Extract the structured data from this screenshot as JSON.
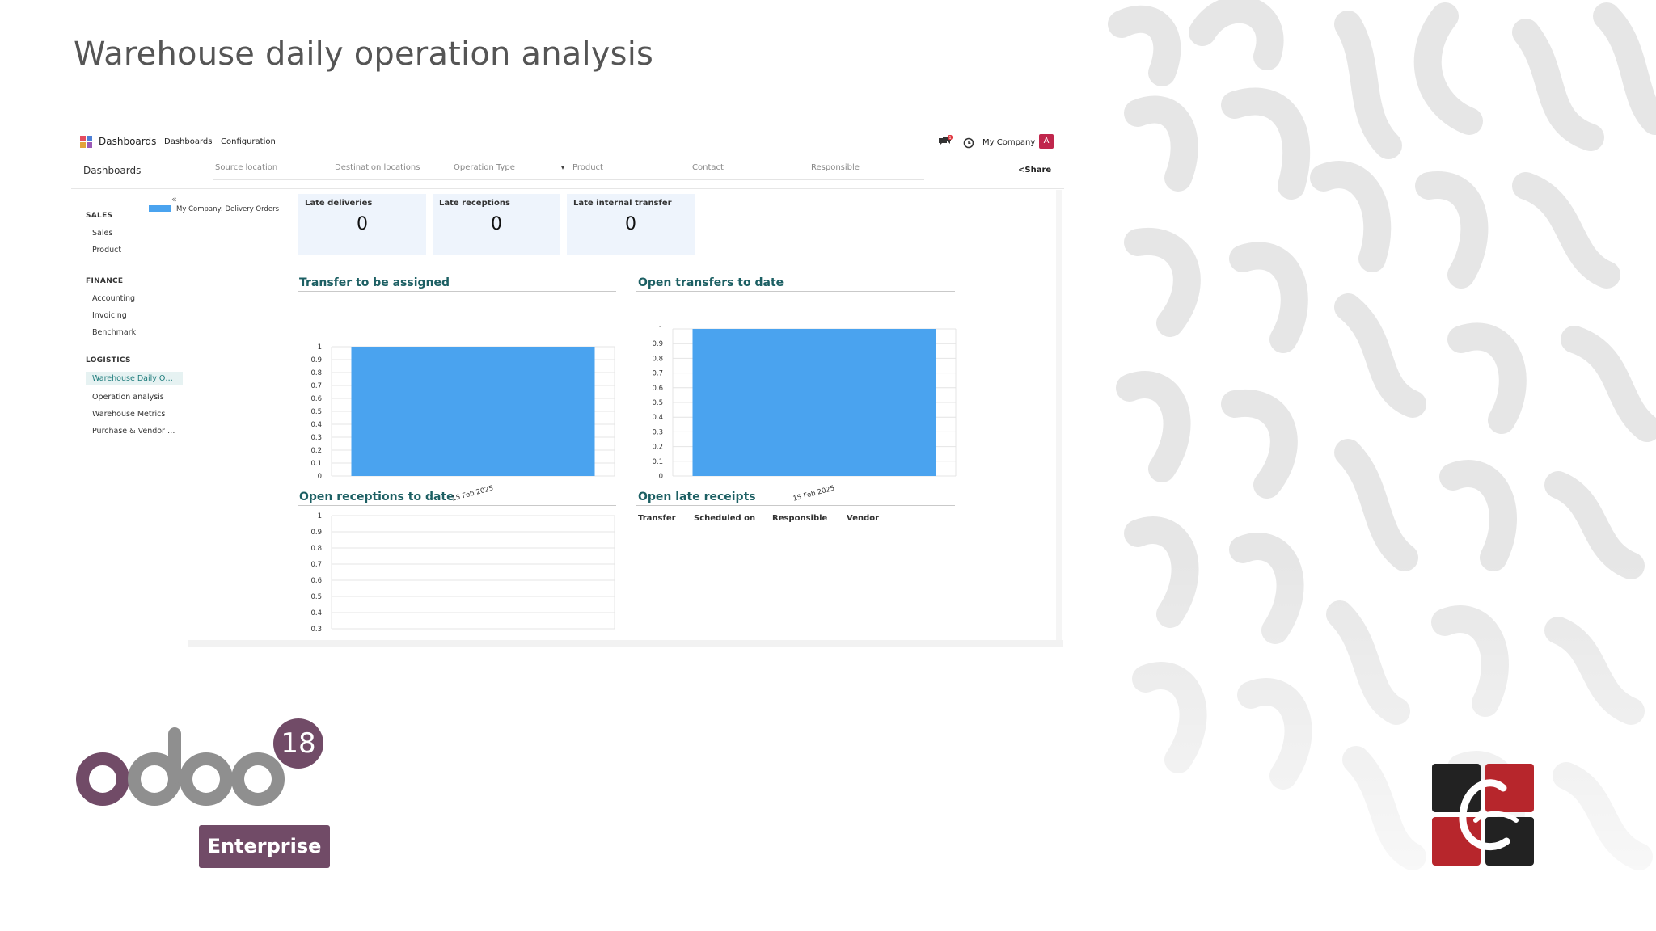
{
  "slide": {
    "title": "Warehouse daily operation analysis"
  },
  "navbar": {
    "app_name": "Dashboards",
    "menu": [
      "Dashboards",
      "Configuration"
    ],
    "chat_badge": "1",
    "company": "My Company",
    "avatar_letter": "A"
  },
  "controlbar": {
    "breadcrumb": "Dashboards",
    "filters": [
      "Source location",
      "Destination locations",
      "Operation Type",
      "Product",
      "Contact",
      "Responsible"
    ],
    "share_label": "Share"
  },
  "sidebar": {
    "toggle": "«",
    "sections": [
      {
        "heading": "SALES",
        "items": [
          "Sales",
          "Product"
        ]
      },
      {
        "heading": "FINANCE",
        "items": [
          "Accounting",
          "Invoicing",
          "Benchmark"
        ]
      },
      {
        "heading": "LOGISTICS",
        "items": [
          "Warehouse Daily O…",
          "Operation analysis",
          "Warehouse Metrics",
          "Purchase & Vendor …"
        ]
      }
    ],
    "active_item": "Warehouse Daily O…"
  },
  "kpis": [
    {
      "label": "Late deliveries",
      "value": "0"
    },
    {
      "label": "Late receptions",
      "value": "0"
    },
    {
      "label": "Late internal transfer",
      "value": "0"
    }
  ],
  "cards": {
    "transfer_assigned": "Transfer to be assigned",
    "open_transfers": "Open transfers to date",
    "open_receptions": "Open receptions to date",
    "late_receipts": "Open late receipts"
  },
  "late_receipts_table": {
    "headers": [
      "Transfer",
      "Scheduled on",
      "Responsible",
      "Vendor"
    ]
  },
  "chart_data": [
    {
      "type": "bar",
      "title": "Transfer to be assigned",
      "categories": [
        "15 Feb 2025"
      ],
      "series": [
        {
          "name": "My Company: Delivery Orders",
          "values": [
            1
          ]
        }
      ],
      "ylim": [
        0,
        1
      ],
      "yticks": [
        "0",
        "0.1",
        "0.2",
        "0.3",
        "0.4",
        "0.5",
        "0.6",
        "0.7",
        "0.8",
        "0.9",
        "1"
      ],
      "legend": "top",
      "grid": true,
      "color": "#4aa3ef"
    },
    {
      "type": "bar",
      "title": "Open transfers to date",
      "categories": [
        "15 Feb 2025"
      ],
      "series": [
        {
          "values": [
            1
          ]
        }
      ],
      "ylim": [
        0,
        1
      ],
      "yticks": [
        "0",
        "0.1",
        "0.2",
        "0.3",
        "0.4",
        "0.5",
        "0.6",
        "0.7",
        "0.8",
        "0.9",
        "1"
      ],
      "grid": true,
      "color": "#4aa3ef"
    },
    {
      "type": "bar",
      "title": "Open receptions to date",
      "categories": [],
      "series": [],
      "ylim": [
        0.3,
        1
      ],
      "yticks": [
        "0.3",
        "0.4",
        "0.5",
        "0.6",
        "0.7",
        "0.8",
        "0.9",
        "1"
      ],
      "grid": true
    }
  ],
  "branding": {
    "version": "18",
    "edition": "Enterprise"
  },
  "colors": {
    "accent": "#1c5f63",
    "odoo_purple": "#714b67",
    "odoo_grey": "#8f8f8f",
    "bar": "#4aa3ef",
    "kpi_bg": "#eef4fc",
    "logo_red": "#b7262c",
    "logo_dark": "#222222"
  }
}
